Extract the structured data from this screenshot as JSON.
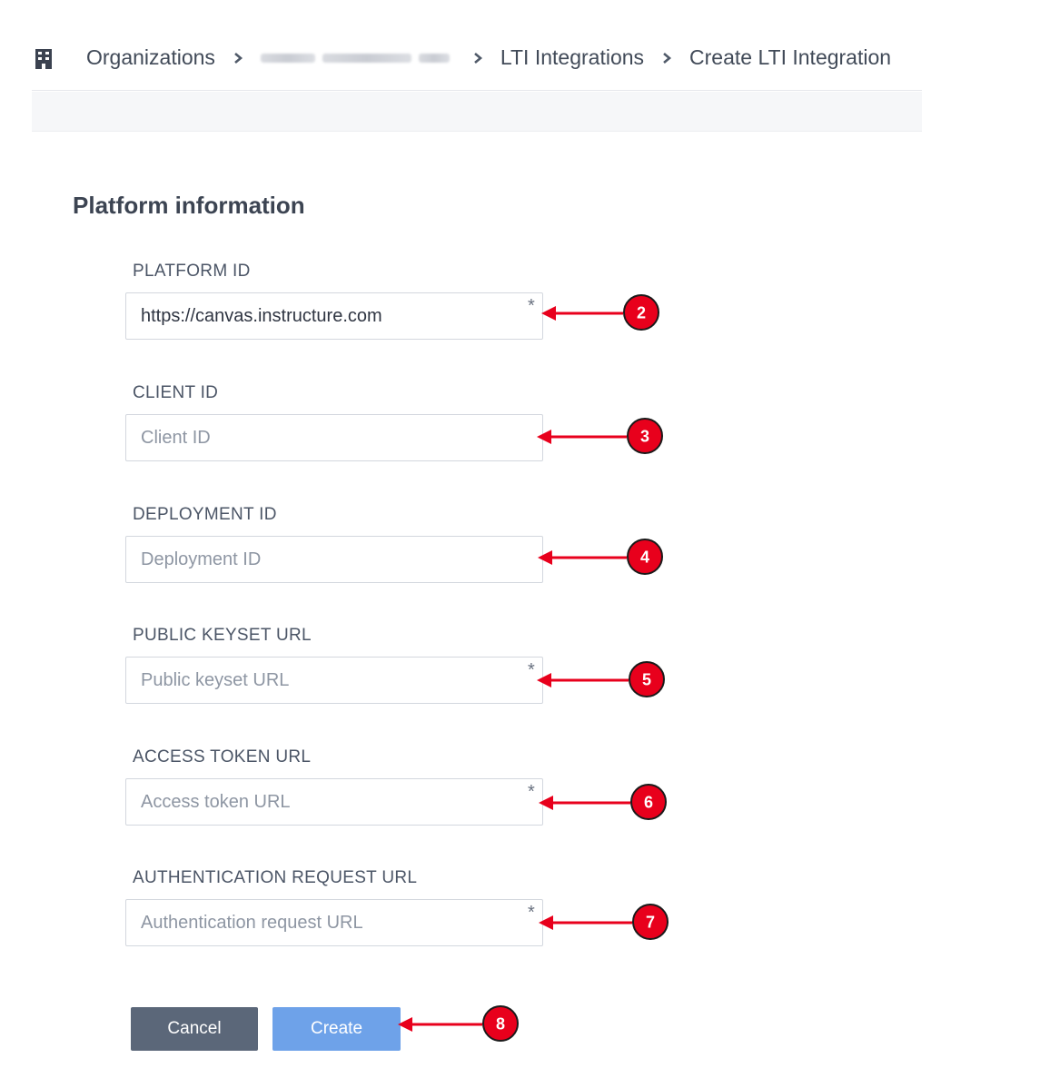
{
  "breadcrumb": {
    "icon": "building-icon",
    "items": [
      "Organizations",
      "LTI Integrations",
      "Create LTI Integration"
    ]
  },
  "section": {
    "title": "Platform information"
  },
  "fields": [
    {
      "label": "PLATFORM ID",
      "value": "https://canvas.instructure.com",
      "placeholder": "",
      "required": "*"
    },
    {
      "label": "CLIENT ID",
      "value": "",
      "placeholder": "Client ID",
      "required": ""
    },
    {
      "label": "DEPLOYMENT ID",
      "value": "",
      "placeholder": "Deployment ID",
      "required": ""
    },
    {
      "label": "PUBLIC KEYSET URL",
      "value": "",
      "placeholder": "Public keyset URL",
      "required": "*"
    },
    {
      "label": "ACCESS TOKEN URL",
      "value": "",
      "placeholder": "Access token URL",
      "required": "*"
    },
    {
      "label": "AUTHENTICATION REQUEST URL",
      "value": "",
      "placeholder": "Authentication request URL",
      "required": "*"
    }
  ],
  "buttons": {
    "cancel": "Cancel",
    "create": "Create"
  },
  "annotations": {
    "color": "#e8001c",
    "steps": [
      "2",
      "3",
      "4",
      "5",
      "6",
      "7",
      "8"
    ]
  },
  "colors": {
    "cancel_button": "#5b6779",
    "create_button": "#6ea2e9"
  }
}
